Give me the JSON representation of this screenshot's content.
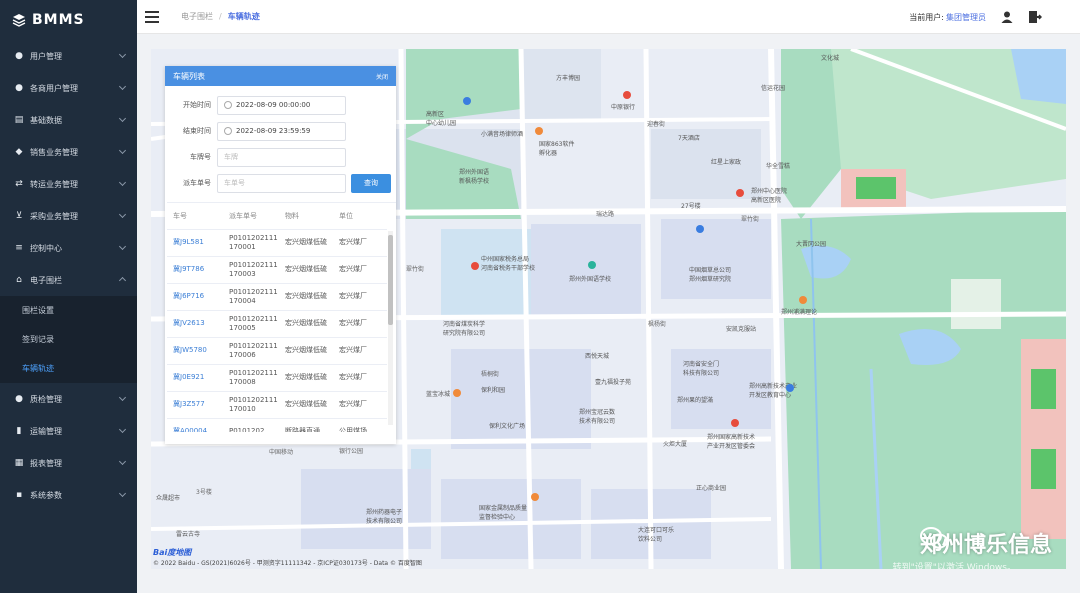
{
  "app": {
    "brand": "BMMS"
  },
  "sidebar": {
    "items": [
      {
        "label": "用户管理",
        "icon": "user-icon"
      },
      {
        "label": "各商用户管理",
        "icon": "users-icon"
      },
      {
        "label": "基础数据",
        "icon": "database-icon"
      },
      {
        "label": "销售业务管理",
        "icon": "tag-icon"
      },
      {
        "label": "转运业务管理",
        "icon": "transfer-icon"
      },
      {
        "label": "采购业务管理",
        "icon": "cart-icon"
      },
      {
        "label": "控制中心",
        "icon": "sliders-icon"
      },
      {
        "label": "电子围栏",
        "icon": "fence-icon",
        "expanded": true
      }
    ],
    "subitems": [
      {
        "label": "围栏设置"
      },
      {
        "label": "签到记录"
      },
      {
        "label": "车辆轨迹",
        "active": true
      }
    ],
    "items_after": [
      {
        "label": "质检管理",
        "icon": "check-icon"
      },
      {
        "label": "运输管理",
        "icon": "truck-icon"
      },
      {
        "label": "报表管理",
        "icon": "report-icon"
      },
      {
        "label": "系统参数",
        "icon": "grid-icon"
      }
    ]
  },
  "header": {
    "breadcrumb": [
      "电子围栏",
      "车辆轨迹"
    ],
    "current_user_label": "当前用户:",
    "current_user": "集团管理员"
  },
  "panel": {
    "title": "车辆列表",
    "close_label": "关闭",
    "start_label": "开始时间",
    "start_value": "2022-08-09 00:00:00",
    "end_label": "结束时间",
    "end_value": "2022-08-09 23:59:59",
    "plate_label": "车牌号",
    "plate_placeholder": "车牌",
    "dispatch_label": "派车单号",
    "dispatch_placeholder": "车单号",
    "query_button": "查询",
    "columns": [
      "车号",
      "派车单号",
      "物料",
      "单位"
    ],
    "rows": [
      {
        "plate": "冀J9L581",
        "order": "P0101202111170001",
        "material": "宏兴烟煤低硫",
        "unit": "宏兴煤厂"
      },
      {
        "plate": "冀J9T786",
        "order": "P0101202111170003",
        "material": "宏兴烟煤低硫",
        "unit": "宏兴煤厂"
      },
      {
        "plate": "冀J6P716",
        "order": "P0101202111170004",
        "material": "宏兴烟煤低硫",
        "unit": "宏兴煤厂"
      },
      {
        "plate": "冀JV2613",
        "order": "P0101202111170005",
        "material": "宏兴烟煤低硫",
        "unit": "宏兴煤厂"
      },
      {
        "plate": "冀JW5780",
        "order": "P0101202111170006",
        "material": "宏兴烟煤低硫",
        "unit": "宏兴煤厂"
      },
      {
        "plate": "冀J0E921",
        "order": "P0101202111170008",
        "material": "宏兴烟煤低硫",
        "unit": "宏兴煤厂"
      },
      {
        "plate": "冀J3Z577",
        "order": "P0101202111170010",
        "material": "宏兴烟煤低硫",
        "unit": "宏兴煤厂"
      },
      {
        "plate": "冀A00004",
        "order": "P0101202",
        "material": "断路器直通",
        "unit": "公用煤场"
      }
    ]
  },
  "map": {
    "labels": {
      "l1": "中原银行",
      "l2": "迎春街",
      "l3": "7天酒店",
      "l4": "郑州外国语\n新枫杨学校",
      "l5": "国家863软件\n孵化器",
      "l6": "7天酒店",
      "l7": "红星上家政",
      "l8": "郑州中心医院\n高新区医院",
      "l9": "翠竹街",
      "l10": "中州国家税务总局\n河南省税务干部学校",
      "l11": "郑州外国语学校",
      "l12": "中国烟草总公司\n郑州烟草研究院",
      "l13": "大晋冈公园",
      "l14": "郑州浦满理论",
      "l15": "河南省煤炭科学\n研究院有限公司",
      "l16": "枫杨街",
      "l17": "安凯克服站",
      "l18": "西悦天城",
      "l19": "壹九福投子苑",
      "l20": "保利和园",
      "l21": "保利文化广场",
      "l22": "郑州宝冠云数\n技术有限公司",
      "l23": "郑州果的望滿",
      "l24": "郑州高新技术产业\n开发区教育中心",
      "l25": "火炬大厦",
      "l26": "郑州国家高新技术\n产业开发区管委会",
      "l27": "中国移动",
      "l28": "银行公园",
      "l29": "国家金属制品质量\n监督检验中心",
      "l30": "郑州药器电子\n技术有限公司",
      "l31": "大连可口可乐\n饮料公司",
      "l32": "正心商业园",
      "l33": "翠竹街",
      "l34": "瑞达路",
      "l35": "27号楼",
      "l36": "方丰博园",
      "l37": "文化城",
      "l38": "中国银行",
      "l39": "信运花园",
      "l40": "高新区\n中心幼儿园",
      "l41": "华全雪糕",
      "l42": "小满音场律师酒",
      "l43": "蓝宝冰城",
      "l44": "河南省安全门\n科技有限公司",
      "l45": "众晟超市",
      "l46": "瑞达路",
      "l47": "梧桐街",
      "l48": "3号楼",
      "l49": "雷云古寺"
    },
    "copyright": "© 2022 Baidu - GS(2021)6026号 - 甲测资字11111342 - 京ICP证030173号 - Data © 百度智图",
    "logo": "Bai度地图",
    "watermark": "郑州博乐信息",
    "win_activate": "转到\"设置\"以激活 Windows。"
  },
  "colors": {
    "sidebar_bg": "#1f2d3d",
    "accent": "#4a90e2",
    "active_link": "#4ea3ff",
    "water": "#a9d1f5",
    "park": "#a8dcc0"
  }
}
